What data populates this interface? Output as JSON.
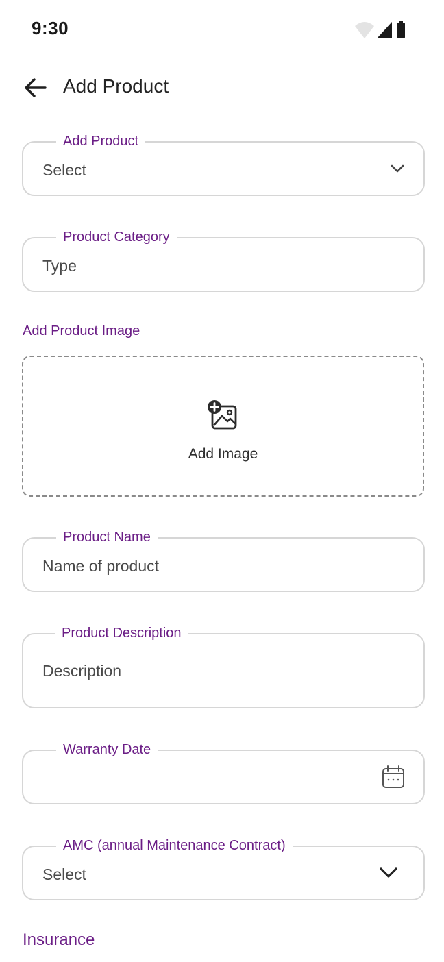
{
  "status_bar": {
    "time": "9:30",
    "icons": [
      "wifi-icon",
      "cellular-signal-icon",
      "battery-icon"
    ]
  },
  "header": {
    "back_icon": "arrow-left-icon",
    "title": "Add Product"
  },
  "form": {
    "add_product": {
      "label": "Add Product",
      "value": "Select",
      "icon": "chevron-down-icon"
    },
    "product_category": {
      "label": "Product Category",
      "placeholder": "Type"
    },
    "product_image": {
      "section_label": "Add Product Image",
      "button_text": "Add Image",
      "icon": "add-image-icon"
    },
    "product_name": {
      "label": "Product Name",
      "placeholder": "Name of product"
    },
    "product_description": {
      "label": "Product Description",
      "placeholder": "Description"
    },
    "warranty_date": {
      "label": "Warranty Date",
      "value": "",
      "icon": "calendar-icon"
    },
    "amc": {
      "label": "AMC (annual Maintenance Contract)",
      "value": "Select",
      "icon": "chevron-down-icon"
    },
    "insurance": {
      "section_label": "Insurance"
    }
  },
  "colors": {
    "accent": "#6b1e86",
    "border": "#d6d6d6",
    "placeholder": "#4a4a4a"
  }
}
